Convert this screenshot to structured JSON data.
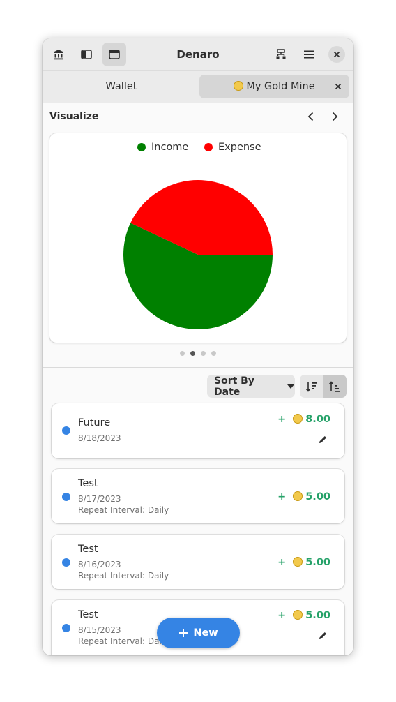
{
  "window": {
    "title": "Denaro"
  },
  "header": {
    "icons": [
      "bank-icon",
      "sidebar-toggle-icon",
      "window-icon",
      "accounts-hierarchy-icon",
      "hamburger-menu-icon",
      "close-icon"
    ]
  },
  "tabs": [
    {
      "label": "Wallet",
      "active": false,
      "has_coin": false
    },
    {
      "label": "My Gold Mine",
      "active": true,
      "has_coin": true
    }
  ],
  "visualize": {
    "title": "Visualize",
    "prev_icon": "chevron-left-icon",
    "next_icon": "chevron-right-icon",
    "page_indicator": {
      "pages": 4,
      "current": 2
    }
  },
  "chart_data": {
    "type": "pie",
    "title": "",
    "labels": [
      "Income",
      "Expense"
    ],
    "values": [
      57,
      43
    ],
    "colors": [
      "#008000",
      "#ff0000"
    ],
    "legend": "top"
  },
  "sort": {
    "label": "Sort By Date",
    "order_buttons": [
      {
        "icon": "sort-descending-icon",
        "selected": false
      },
      {
        "icon": "sort-ascending-icon",
        "selected": true
      }
    ]
  },
  "transactions": [
    {
      "name": "Future",
      "date": "8/18/2023",
      "repeat": "",
      "sign": "+",
      "amount": "8.00",
      "editable": true
    },
    {
      "name": "Test",
      "date": "8/17/2023",
      "repeat": "Repeat Interval: Daily",
      "sign": "+",
      "amount": "5.00",
      "editable": false
    },
    {
      "name": "Test",
      "date": "8/16/2023",
      "repeat": "Repeat Interval: Daily",
      "sign": "+",
      "amount": "5.00",
      "editable": false
    },
    {
      "name": "Test",
      "date": "8/15/2023",
      "repeat": "Repeat Interval: Daily",
      "sign": "+",
      "amount": "5.00",
      "editable": true
    }
  ],
  "new_button": {
    "label": "New"
  },
  "colors": {
    "accent": "#3584e4",
    "income_amount": "#26a269",
    "transaction_dot": "#3584e4"
  }
}
